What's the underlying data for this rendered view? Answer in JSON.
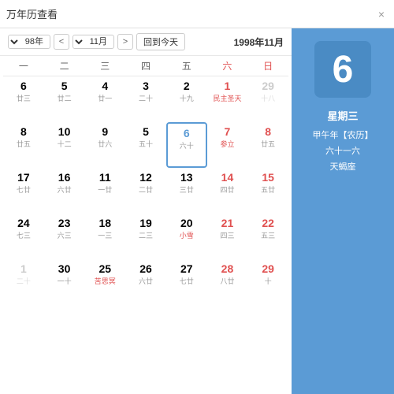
{
  "window": {
    "title": "万年历查看",
    "close_label": "×"
  },
  "left_panel": {
    "day": "6",
    "weekday": "星期三",
    "line1": "【农历】甲午年",
    "line2": "六十一六",
    "line3": "天蝎座"
  },
  "header": {
    "today_btn": "回到今天",
    "prev_label": "<",
    "next_label": ">",
    "month_value": "11月",
    "year_value": "98年",
    "full_label": "1998年11月"
  },
  "weekdays": [
    "日",
    "六",
    "五",
    "四",
    "三",
    "二",
    "一"
  ],
  "weeks": [
    [
      {
        "solar": "29",
        "lunar": "十八",
        "type": "normal",
        "isOtherMonth": true
      },
      {
        "solar": "1",
        "lunar": "民主圣天",
        "type": "holiday",
        "isOtherMonth": false
      },
      {
        "solar": "2",
        "lunar": "十九",
        "type": "normal",
        "isOtherMonth": false
      },
      {
        "solar": "3",
        "lunar": "二十",
        "type": "normal",
        "isOtherMonth": false
      },
      {
        "solar": "4",
        "lunar": "廿一",
        "type": "normal",
        "isOtherMonth": false
      },
      {
        "solar": "5",
        "lunar": "廿二",
        "type": "normal",
        "isOtherMonth": false
      },
      {
        "solar": "6",
        "lunar": "廿三",
        "type": "normal",
        "isOtherMonth": false
      }
    ],
    [
      {
        "solar": "8",
        "lunar": "廿五",
        "type": "normal",
        "isOtherMonth": false
      },
      {
        "solar": "7",
        "lunar": "参立",
        "type": "special",
        "isOtherMonth": false
      },
      {
        "solar": "6",
        "lunar": "六十",
        "type": "today",
        "isOtherMonth": false
      },
      {
        "solar": "5",
        "lunar": "五十",
        "type": "normal",
        "isOtherMonth": false
      },
      {
        "solar": "9",
        "lunar": "廿六",
        "type": "normal",
        "isOtherMonth": false
      },
      {
        "solar": "10",
        "lunar": "十二",
        "type": "normal",
        "isOtherMonth": false
      },
      {
        "solar": "8",
        "lunar": "廿五",
        "type": "normal",
        "isOtherMonth": false
      }
    ],
    [
      {
        "solar": "15",
        "lunar": "五廿",
        "type": "normal",
        "isOtherMonth": false
      },
      {
        "solar": "14",
        "lunar": "四廿",
        "type": "normal",
        "isOtherMonth": false
      },
      {
        "solar": "13",
        "lunar": "三廿",
        "type": "normal",
        "isOtherMonth": false
      },
      {
        "solar": "12",
        "lunar": "二廿",
        "type": "normal",
        "isOtherMonth": false
      },
      {
        "solar": "11",
        "lunar": "一廿",
        "type": "normal",
        "isOtherMonth": false
      },
      {
        "solar": "16",
        "lunar": "六廿",
        "type": "normal",
        "isOtherMonth": false
      },
      {
        "solar": "17",
        "lunar": "七廿",
        "type": "normal",
        "isOtherMonth": false
      }
    ],
    [
      {
        "solar": "22",
        "lunar": "五三",
        "type": "normal",
        "isOtherMonth": false
      },
      {
        "solar": "21",
        "lunar": "四三",
        "type": "normal",
        "isOtherMonth": false
      },
      {
        "solar": "20",
        "lunar": "小雪",
        "type": "holiday",
        "isOtherMonth": false
      },
      {
        "solar": "19",
        "lunar": "二三",
        "type": "normal",
        "isOtherMonth": false
      },
      {
        "solar": "18",
        "lunar": "一三",
        "type": "normal",
        "isOtherMonth": false
      },
      {
        "solar": "23",
        "lunar": "六三",
        "type": "normal",
        "isOtherMonth": false
      },
      {
        "solar": "24",
        "lunar": "七三",
        "type": "normal",
        "isOtherMonth": false
      }
    ],
    [
      {
        "solar": "29",
        "lunar": "十",
        "type": "normal",
        "isOtherMonth": false
      },
      {
        "solar": "28",
        "lunar": "八廿",
        "type": "normal",
        "isOtherMonth": false
      },
      {
        "solar": "27",
        "lunar": "七廿",
        "type": "normal",
        "isOtherMonth": false
      },
      {
        "solar": "26",
        "lunar": "六廿",
        "type": "normal",
        "isOtherMonth": false
      },
      {
        "solar": "25",
        "lunar": "苦思冥",
        "type": "holiday",
        "isOtherMonth": false
      },
      {
        "solar": "30",
        "lunar": "一十",
        "type": "normal",
        "isOtherMonth": false
      },
      {
        "solar": "1",
        "lunar": "二十",
        "type": "normal",
        "isOtherMonth": true
      }
    ]
  ]
}
